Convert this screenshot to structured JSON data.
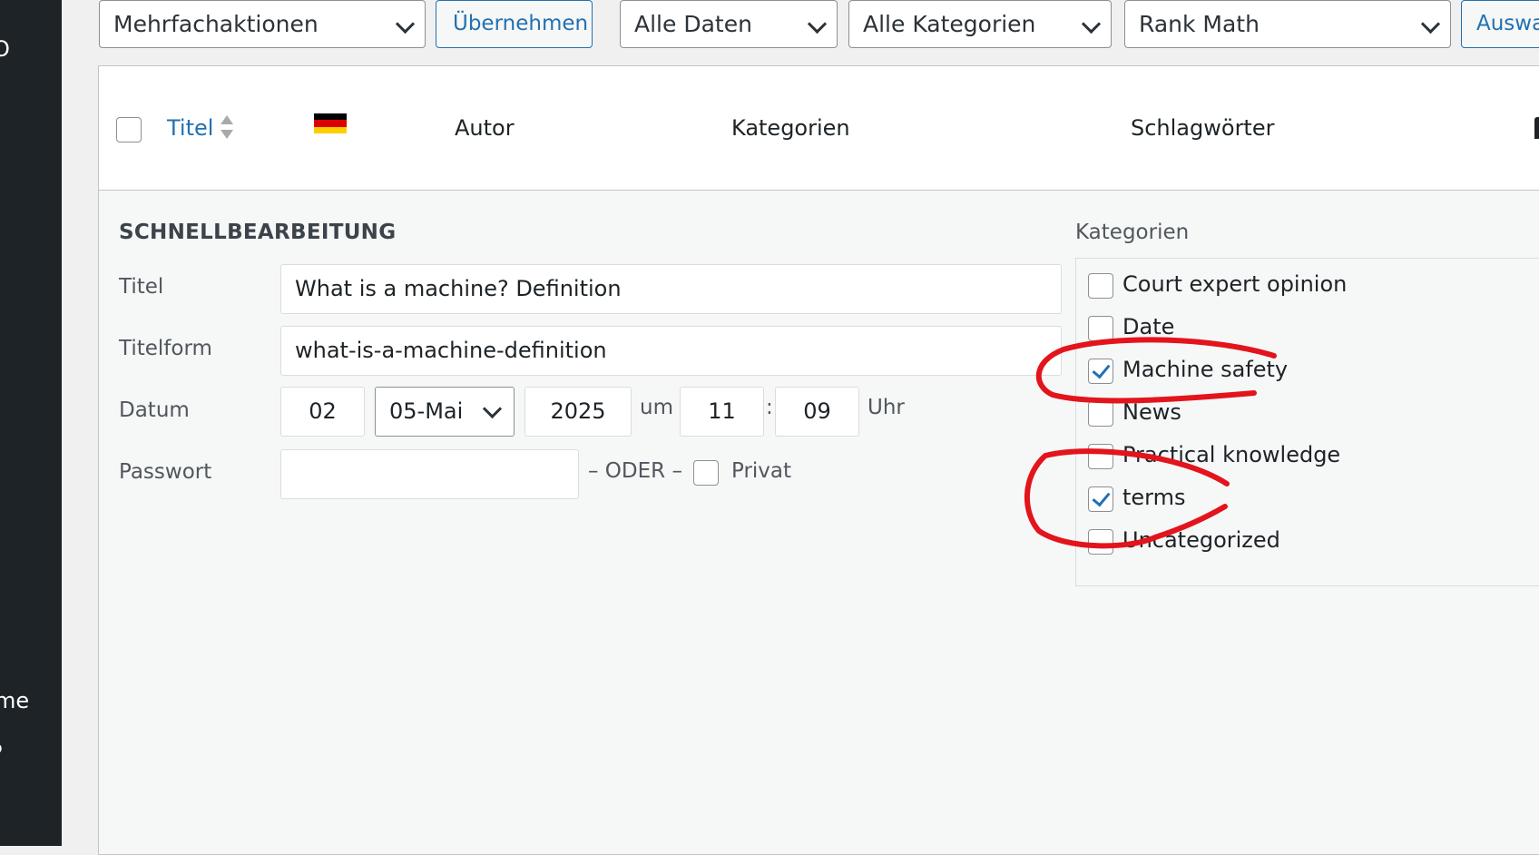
{
  "sidebar": {
    "items": [
      {
        "label": "O"
      },
      {
        "label": "me"
      },
      {
        "label": "P"
      }
    ]
  },
  "toolbar": {
    "bulk_actions": "Mehrfachaktionen",
    "apply_label": "Übernehmen",
    "dates_filter": "Alle Daten",
    "categories_filter": "Alle Kategorien",
    "seo_filter": "Rank Math",
    "filter_button": "Auswa"
  },
  "table": {
    "columns": {
      "title": "Titel",
      "author": "Autor",
      "categories": "Kategorien",
      "tags": "Schlagwörter"
    },
    "flag_colors": [
      "#000000",
      "#dd0000",
      "#ffce00"
    ]
  },
  "quick_edit": {
    "heading": "SCHNELLBEARBEITUNG",
    "title_label": "Titel",
    "title_value": "What is a machine? Definition",
    "slug_label": "Titelform",
    "slug_value": "what-is-a-machine-definition",
    "date_label": "Datum",
    "day": "02",
    "month": "05-Mai",
    "year": "2025",
    "at_label": "um",
    "hour": "11",
    "time_sep": ":",
    "minute": "09",
    "clock_label": "Uhr",
    "password_label": "Passwort",
    "password_value": "",
    "or_label": "– ODER –",
    "private_label": "Privat",
    "categories_label": "Kategorien",
    "categories": [
      {
        "label": "Court expert opinion",
        "checked": false
      },
      {
        "label": "Date",
        "checked": false
      },
      {
        "label": "Machine safety",
        "checked": true
      },
      {
        "label": "News",
        "checked": false
      },
      {
        "label": "Practical knowledge",
        "checked": false
      },
      {
        "label": "terms",
        "checked": true
      },
      {
        "label": "Uncategorized",
        "checked": false
      }
    ]
  },
  "colors": {
    "accent": "#2271b1",
    "annotation": "#e3141b",
    "sidebar": "#1d2327"
  }
}
